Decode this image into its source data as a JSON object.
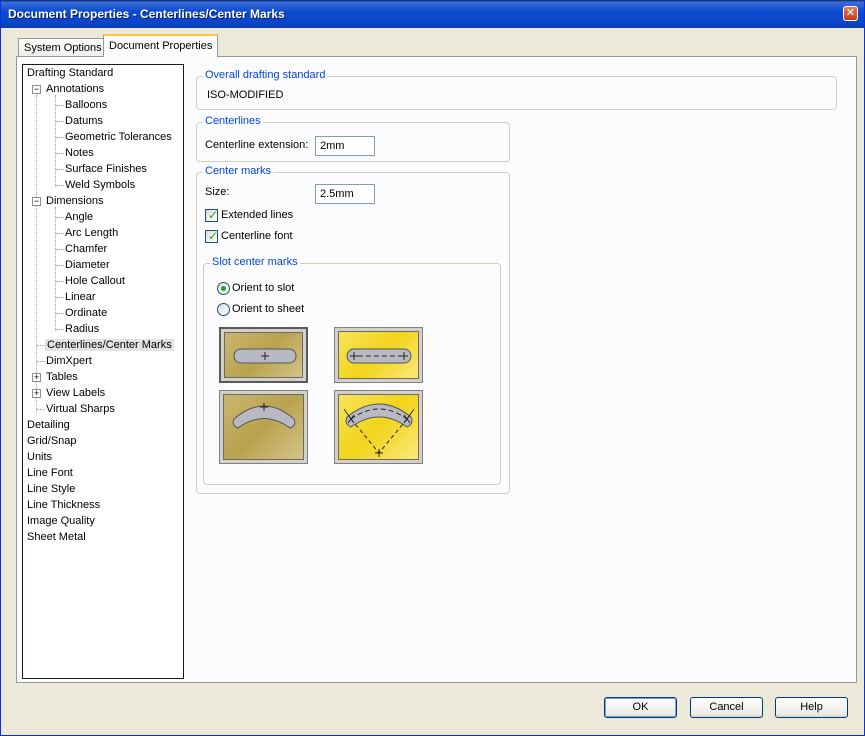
{
  "window": {
    "title": "Document Properties - Centerlines/Center Marks",
    "close_glyph": "✕"
  },
  "tabs": [
    {
      "label": "System Options",
      "active": false
    },
    {
      "label": "Document Properties",
      "active": true
    }
  ],
  "tree": {
    "items": [
      {
        "label": "Drafting Standard"
      },
      {
        "label": "Annotations"
      },
      {
        "label": "Balloons"
      },
      {
        "label": "Datums"
      },
      {
        "label": "Geometric Tolerances"
      },
      {
        "label": "Notes"
      },
      {
        "label": "Surface Finishes"
      },
      {
        "label": "Weld Symbols"
      },
      {
        "label": "Dimensions"
      },
      {
        "label": "Angle"
      },
      {
        "label": "Arc Length"
      },
      {
        "label": "Chamfer"
      },
      {
        "label": "Diameter"
      },
      {
        "label": "Hole Callout"
      },
      {
        "label": "Linear"
      },
      {
        "label": "Ordinate"
      },
      {
        "label": "Radius"
      },
      {
        "label": "Centerlines/Center Marks"
      },
      {
        "label": "DimXpert"
      },
      {
        "label": "Tables"
      },
      {
        "label": "View Labels"
      },
      {
        "label": "Virtual Sharps"
      },
      {
        "label": "Detailing"
      },
      {
        "label": "Grid/Snap"
      },
      {
        "label": "Units"
      },
      {
        "label": "Line Font"
      },
      {
        "label": "Line Style"
      },
      {
        "label": "Line Thickness"
      },
      {
        "label": "Image Quality"
      },
      {
        "label": "Sheet Metal"
      }
    ],
    "selected": "Centerlines/Center Marks",
    "expander_minus": "−",
    "expander_plus": "+"
  },
  "overall": {
    "legend": "Overall drafting standard",
    "value": "ISO-MODIFIED"
  },
  "centerlines": {
    "legend": "Centerlines",
    "extension_label": "Centerline extension:",
    "extension_value": "2mm"
  },
  "center_marks": {
    "legend": "Center marks",
    "size_label": "Size:",
    "size_value": "2.5mm",
    "extended_lines": {
      "label": "Extended lines",
      "checked": true
    },
    "centerline_font": {
      "label": "Centerline font",
      "checked": true
    },
    "check_glyph": "✓"
  },
  "slot_center_marks": {
    "legend": "Slot center marks",
    "orient_to_slot": {
      "label": "Orient to slot",
      "checked": true
    },
    "orient_to_sheet": {
      "label": "Orient to sheet",
      "checked": false
    }
  },
  "buttons": {
    "ok": "OK",
    "cancel": "Cancel",
    "help": "Help"
  },
  "colors": {
    "titlebar": "#0845c8",
    "group_legend": "#0046d5",
    "check": "#21a121"
  }
}
